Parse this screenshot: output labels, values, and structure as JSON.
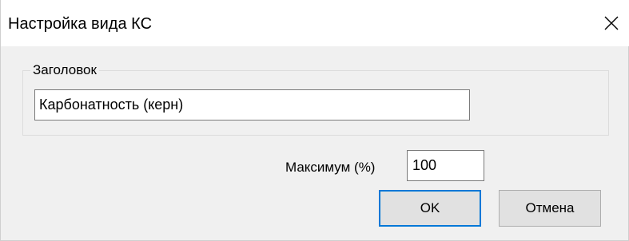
{
  "window": {
    "title": "Настройка вида КС",
    "close_icon": "close-icon"
  },
  "group": {
    "label": "Заголовок",
    "title_value": "Карбонатность (керн)"
  },
  "maximum": {
    "label": "Максимум (%)",
    "value": "100"
  },
  "buttons": {
    "ok": "OK",
    "cancel": "Отмена"
  },
  "colors": {
    "background": "#f0f0f0",
    "titlebar": "#ffffff",
    "default_button_border": "#0078d7",
    "button_face": "#e1e1e1"
  }
}
